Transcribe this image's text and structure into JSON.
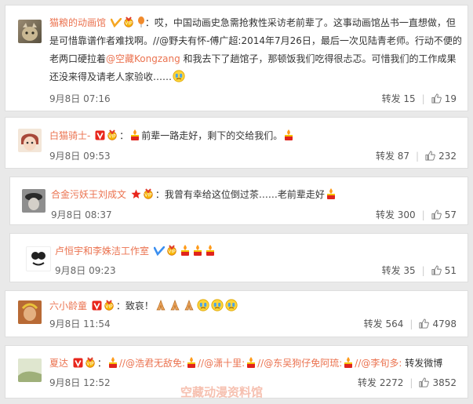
{
  "comments": [
    {
      "user": "猫粮的动画馆",
      "lines": [
        "：哎，中国动画史急需抢救性采访老前辈了。这事动画馆丛书一直想做，但",
        "是可惜靠谱作者难找啊。//@野夫有怀-傅广超:2014年7月26日，最后一次见陆青老师。行动不便的",
        "老两口硬拉着",
        "@空藏Kongzang",
        " 和我去下了趟馆子，那顿饭我们吃得很忐忑。可惜我们的工作成果",
        "还没来得及请老人家验收……"
      ],
      "date": "9月8日 07:16",
      "repost": "转发 15",
      "likes": "19"
    },
    {
      "user": "白猫骑士-",
      "text": "：",
      "text2": "前辈一路走好，剩下的交给我们。",
      "date": "9月8日 09:53",
      "repost": "转发 87",
      "likes": "232"
    },
    {
      "user": "合金污妖王刘成文",
      "text": "：我曾有幸给这位倒过茶……老前辈走好",
      "date": "9月8日 08:37",
      "repost": "转发 300",
      "likes": "57"
    },
    {
      "user": "卢恒宇和李姝洁工作室",
      "text": "",
      "date": "9月8日 09:23",
      "repost": "转发 35",
      "likes": "51"
    },
    {
      "user": "六小龄童",
      "text": "：致哀！",
      "date": "9月8日 11:54",
      "repost": "转发 564",
      "likes": "4798"
    },
    {
      "user": "夏达",
      "seg1": "//@浩君无敌免:",
      "seg2": "//@潇十里:",
      "seg3": "//@东吴狗仔免阿琉:",
      "seg4": "//@李旬多:",
      "seg5": " 转发微博",
      "date": "9月8日 12:52",
      "repost": "转发 2272",
      "likes": "3852"
    }
  ],
  "watermark": "空藏动漫资料馆"
}
